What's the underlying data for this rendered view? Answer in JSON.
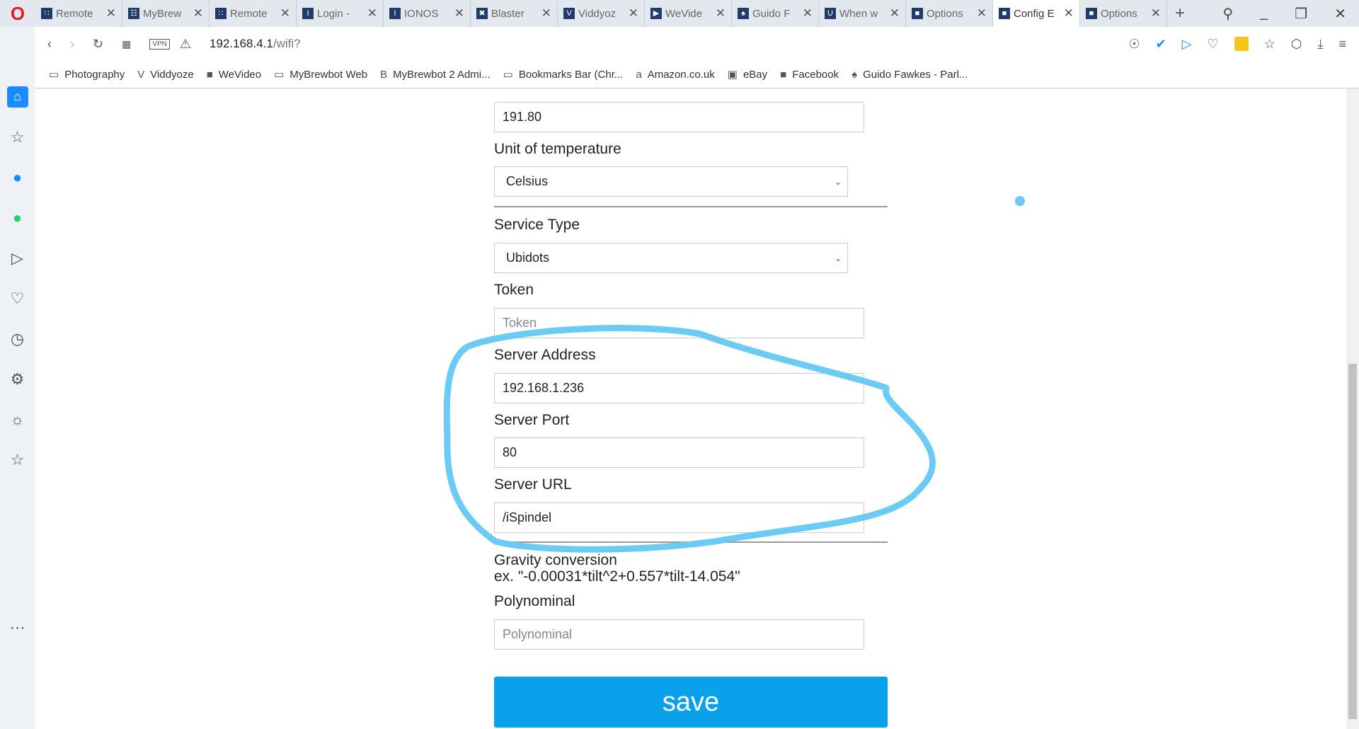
{
  "browser": {
    "tabs": [
      {
        "label": "Remote",
        "icon": "grid-icon"
      },
      {
        "label": "MyBrew",
        "icon": "brew-icon"
      },
      {
        "label": "Remote",
        "icon": "grid-icon"
      },
      {
        "label": "Login -",
        "icon": "ionos-icon"
      },
      {
        "label": "IONOS",
        "icon": "ionos-icon"
      },
      {
        "label": "Blaster",
        "icon": "blaster-icon"
      },
      {
        "label": "Viddyoz",
        "icon": "viddyoze-icon"
      },
      {
        "label": "WeVide",
        "icon": "wevideo-icon"
      },
      {
        "label": "Guido F",
        "icon": "guido-icon"
      },
      {
        "label": "When w",
        "icon": "u-icon"
      },
      {
        "label": "Options",
        "icon": "page-icon"
      },
      {
        "label": "Config E",
        "icon": "page-icon",
        "active": true
      },
      {
        "label": "Options",
        "icon": "page-icon"
      }
    ],
    "url_host": "192.168.4.1",
    "url_path": "/wifi?",
    "vpn_label": "VPN",
    "bookmarks": [
      {
        "label": "Photography",
        "icon": "folder-icon"
      },
      {
        "label": "Viddyoze",
        "icon": "viddyoze-icon"
      },
      {
        "label": "WeVideo",
        "icon": "page-icon"
      },
      {
        "label": "MyBrewbot Web",
        "icon": "folder-icon"
      },
      {
        "label": "MyBrewbot 2 Admi...",
        "icon": "b-icon"
      },
      {
        "label": "Bookmarks Bar (Chr...",
        "icon": "folder-icon"
      },
      {
        "label": "Amazon.co.uk",
        "icon": "amazon-icon"
      },
      {
        "label": "eBay",
        "icon": "ebay-icon"
      },
      {
        "label": "Facebook",
        "icon": "page-icon"
      },
      {
        "label": "Guido Fawkes - Parl...",
        "icon": "guido-icon"
      }
    ]
  },
  "form": {
    "top_value": "191.80",
    "unit_label": "Unit of temperature",
    "unit_value": "Celsius",
    "service_label": "Service Type",
    "service_value": "Ubidots",
    "token_label": "Token",
    "token_placeholder": "Token",
    "server_address_label": "Server Address",
    "server_address_value": "192.168.1.236",
    "server_port_label": "Server Port",
    "server_port_value": "80",
    "server_url_label": "Server URL",
    "server_url_value": "/iSpindel",
    "gravity_label": "Gravity conversion",
    "gravity_example": "ex. \"-0.00031*tilt^2+0.557*tilt-14.054\"",
    "poly_label": "Polynominal",
    "poly_placeholder": "Polynominal",
    "save_label": "save"
  },
  "annotation_color": "#6ccbf4"
}
